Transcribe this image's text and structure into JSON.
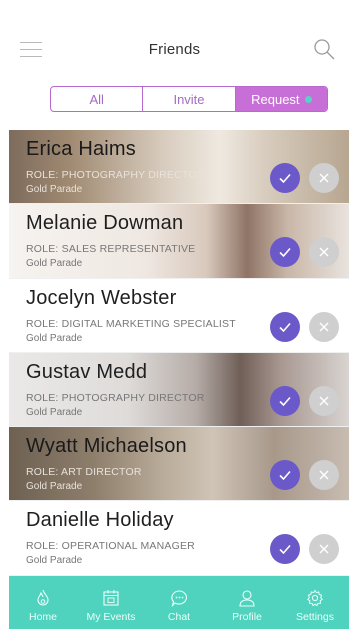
{
  "header": {
    "title": "Friends"
  },
  "tabs": [
    {
      "label": "All",
      "active": false
    },
    {
      "label": "Invite",
      "active": false
    },
    {
      "label": "Request",
      "active": true
    }
  ],
  "friends": [
    {
      "name": "Erica Haims",
      "role": "ROLE: PHOTOGRAPHY DIRECTOR",
      "company": "Gold Parade"
    },
    {
      "name": "Melanie Dowman",
      "role": "ROLE: SALES REPRESENTATIVE",
      "company": "Gold Parade"
    },
    {
      "name": "Jocelyn Webster",
      "role": "ROLE: DIGITAL MARKETING SPECIALIST",
      "company": "Gold Parade"
    },
    {
      "name": "Gustav Medd",
      "role": "ROLE: PHOTOGRAPHY DIRECTOR",
      "company": "Gold Parade"
    },
    {
      "name": "Wyatt Michaelson",
      "role": "ROLE: ART DIRECTOR",
      "company": "Gold Parade"
    },
    {
      "name": "Danielle Holiday",
      "role": "ROLE: OPERATIONAL MANAGER",
      "company": "Gold Parade"
    }
  ],
  "tabbar": [
    {
      "label": "Home",
      "icon": "flame-icon"
    },
    {
      "label": "My Events",
      "icon": "calendar-icon"
    },
    {
      "label": "Chat",
      "icon": "chat-bubble-icon"
    },
    {
      "label": "Profile",
      "icon": "person-icon"
    },
    {
      "label": "Settings",
      "icon": "gear-icon"
    }
  ],
  "colors": {
    "accent_purple": "#c76fd6",
    "accept_button": "#6b59c9",
    "decline_button": "#cfcfcf",
    "tabbar_teal": "#4fd3bf",
    "request_dot": "#52d6c3"
  }
}
